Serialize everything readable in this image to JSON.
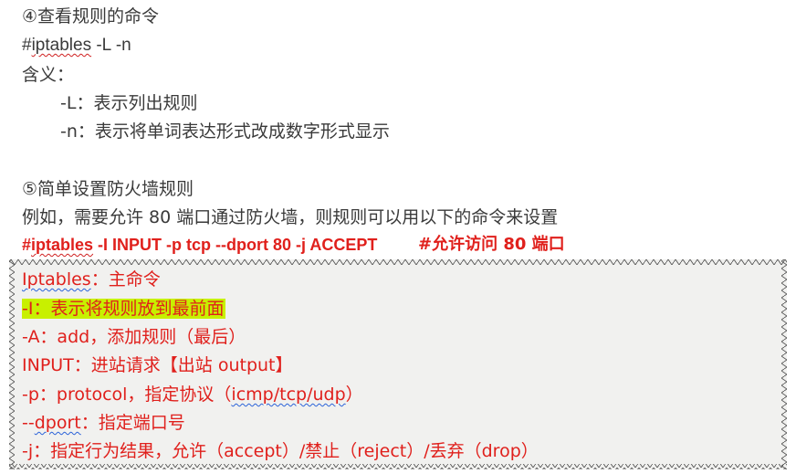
{
  "sec4": {
    "heading": "④查看规则的命令",
    "cmd_prefix": "#",
    "cmd_word": "iptables",
    "cmd_rest": " -L -n",
    "meaning_label": "含义：",
    "item_l": "-L：表示列出规则",
    "item_n": "-n：表示将单词表达形式改成数字形式显示"
  },
  "sec5": {
    "heading": "⑤简单设置防火墙规则",
    "intro": "例如，需要允许 80 端口通过防火墙，则规则可以用以下的命令来设置",
    "cmd_prefix": "#",
    "cmd_word": "iptables",
    "cmd_rest": " -I INPUT -p tcp --dport 80 -j ACCEPT",
    "cmd_comment": "#允许访问 80 端口"
  },
  "box": {
    "line1_word": "Iptables",
    "line1_rest": "：主命令",
    "line2": "-I：表示将规则放到最前面",
    "line3": "-A：add，添加规则（最后）",
    "line4": "INPUT：进站请求【出站 output】",
    "line5_pre": "-p：protocol，指定协议（",
    "line5_word": "icmp/tcp/udp",
    "line5_post": "）",
    "line6_pre": "--",
    "line6_word": "dport",
    "line6_post": "：指定端口号",
    "line7": "-j：指定行为结果，允许（accept）/禁止（reject）/丢弃（drop）"
  },
  "colors": {
    "body_text": "#3a3a3a",
    "accent_red": "#e0201c",
    "highlight": "#c8f000",
    "box_bg": "#f1f1ef"
  }
}
